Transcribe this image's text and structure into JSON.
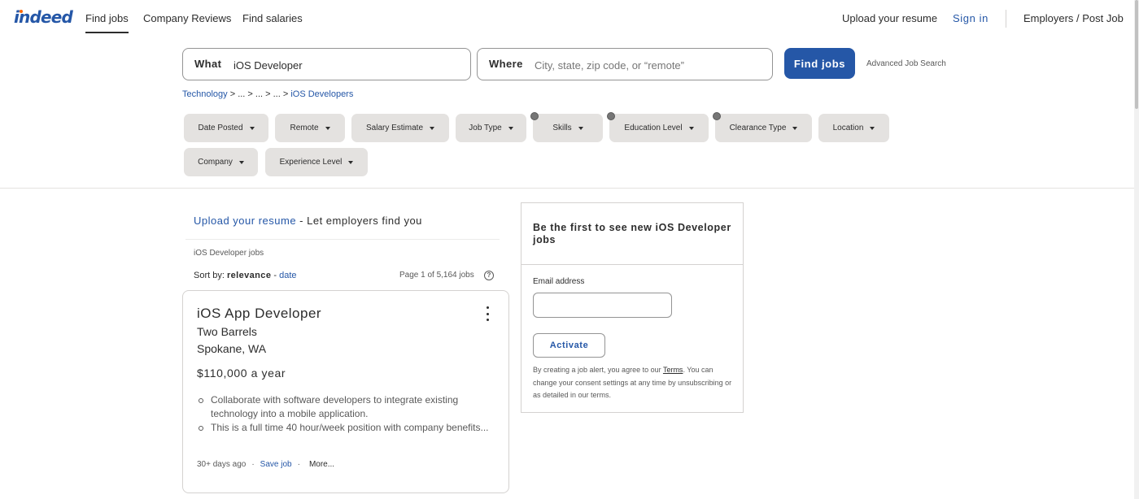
{
  "header": {
    "logo": "indeed",
    "nav": {
      "find_jobs": "Find jobs",
      "company_reviews": "Company Reviews",
      "find_salaries": "Find salaries"
    },
    "right": {
      "upload_resume": "Upload your resume",
      "sign_in": "Sign in",
      "employers": "Employers / Post Job"
    }
  },
  "search": {
    "what_label": "What",
    "what_value": "iOS Developer",
    "where_label": "Where",
    "where_placeholder": "City, state, zip code, or “remote”",
    "find_button": "Find jobs",
    "advanced": "Advanced Job Search"
  },
  "breadcrumb": {
    "root": "Technology",
    "middle": " > ... > ... > ... > ",
    "current": "iOS Developers"
  },
  "filters": [
    "Date Posted",
    "Remote",
    "Salary Estimate",
    "Job Type",
    "Skills",
    "Education Level",
    "Clearance Type",
    "Location",
    "Company",
    "Experience Level"
  ],
  "results": {
    "upload_link": "Upload your resume",
    "upload_rest": " - Let employers find you",
    "heading": "iOS Developer jobs",
    "sort_prefix": "Sort by: ",
    "sort_relevance": "relevance",
    "sort_sep": " - ",
    "sort_date": "date",
    "page_count": "Page 1 of 5,164 jobs",
    "help_icon": "?"
  },
  "job": {
    "title": "iOS App Developer",
    "company": "Two Barrels",
    "location": "Spokane, WA",
    "salary": "$110,000 a year",
    "snippets": [
      "Collaborate with software developers to integrate existing technology into a mobile application.",
      "This is a full time 40 hour/week position with company benefits..."
    ],
    "posted": "30+ days ago",
    "dot": "·",
    "save": "Save job",
    "more": "More..."
  },
  "alert": {
    "title": "Be the first to see new iOS Developer jobs",
    "email_label": "Email address",
    "email_value": "",
    "activate": "Activate",
    "legal_before": "By creating a job alert, you agree to our ",
    "legal_terms": "Terms",
    "legal_after": ". You can change your consent settings at any time by unsubscribing or as detailed in our terms."
  },
  "colors": {
    "brand": "#2557a7",
    "text": "#2d2d2d",
    "muted": "#595959",
    "chip": "#e4e2e0"
  }
}
